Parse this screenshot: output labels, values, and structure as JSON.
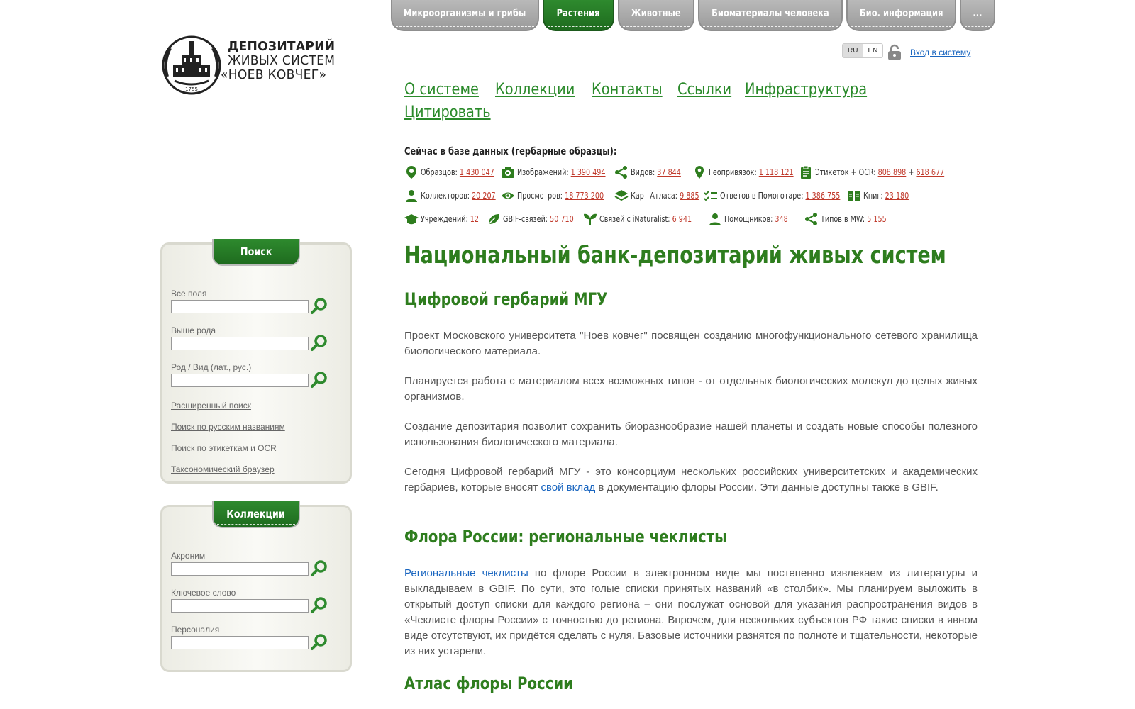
{
  "tabs": [
    {
      "label": "Микроорганизмы и грибы",
      "active": false
    },
    {
      "label": "Растения",
      "active": true
    },
    {
      "label": "Животные",
      "active": false
    },
    {
      "label": "Биоматериалы человека",
      "active": false
    },
    {
      "label": "Био. информация",
      "active": false
    },
    {
      "label": "...",
      "active": false
    }
  ],
  "logo": {
    "line1": "ДЕПОЗИТАРИЙ",
    "line2": "ЖИВЫХ СИСТЕМ",
    "line3": "«НОЕВ КОВЧЕГ»",
    "year": "1755"
  },
  "lang": {
    "ru": "RU",
    "en": "EN"
  },
  "login": "Вход в систему",
  "menu": [
    "О системе",
    "Коллекции",
    "Контакты",
    "Ссылки",
    "Инфраструктура",
    "Цитировать"
  ],
  "stats": {
    "title": "Сейчас в базе данных (гербарные образцы):",
    "row1": [
      {
        "icon": "leaf-pin-icon",
        "label": "Образцов:",
        "value": "1 430 047"
      },
      {
        "icon": "camera-icon",
        "label": "Изображений:",
        "value": "1 390 494"
      },
      {
        "icon": "share-icon",
        "label": "Видов:",
        "value": "37 844"
      },
      {
        "icon": "map-pin-icon",
        "label": "Геопривязок:",
        "value": "1 118 121"
      },
      {
        "icon": "clipboard-icon",
        "label": "Этикеток + OCR:",
        "value": "808 898",
        "plus": "+",
        "value2": "618 677"
      }
    ],
    "row2": [
      {
        "icon": "person-icon",
        "label": "Коллекторов:",
        "value": "20 207"
      },
      {
        "icon": "eye-icon",
        "label": "Просмотров:",
        "value": "18 773 200"
      },
      {
        "icon": "layers-icon",
        "label": "Карт Атласа:",
        "value": "9 885"
      },
      {
        "icon": "checklist-icon",
        "label": "Ответов в Помоготаре:",
        "value": "1 386 755"
      },
      {
        "icon": "book-icon",
        "label": "Книг:",
        "value": "23 180"
      }
    ],
    "row3": [
      {
        "icon": "graduation-cap-icon",
        "label": "Учреждений:",
        "value": "12"
      },
      {
        "icon": "leaf-icon",
        "label": "GBIF-связей:",
        "value": "50 710"
      },
      {
        "icon": "sprout-icon",
        "label": "Связей с iNaturalist:",
        "value": "6 941"
      },
      {
        "icon": "person-icon",
        "label": "Помощников:",
        "value": "348"
      },
      {
        "icon": "share-icon",
        "label": "Типов в MW:",
        "value": "5 155"
      }
    ]
  },
  "search": {
    "title": "Поиск",
    "fields": [
      "Все поля",
      "Выше рода",
      "Род / Вид (лат., рус.)"
    ],
    "links": [
      "Расширенный поиск",
      "Поиск по русским названиям",
      "Поиск по этикеткам и OCR",
      "Таксономический браузер"
    ]
  },
  "collections": {
    "title": "Коллекции",
    "fields": [
      "Акроним",
      "Ключевое слово",
      "Персоналия"
    ]
  },
  "main": {
    "h1": "Национальный банк-депозитарий живых систем",
    "h2a": "Цифровой гербарий МГУ",
    "p1": "Проект Московского университета \"Ноев ковчег\" посвящен созданию многофункционального сетевого хранилища биологического материала.",
    "p2": "Планируется работа с материалом всех возможных типов - от отдельных биологических молекул до целых живых организмов.",
    "p3": "Создание депозитария позволит сохранить биоразнообразие нашей планеты и создать новые способы полезного использования биологического материала.",
    "p4a": "Сегодня Цифровой гербарий МГУ - это консорциум нескольких российских университетских и академических гербариев, которые вносят ",
    "p4link": "свой вклад",
    "p4b": " в документацию флоры России. Эти данные доступны также в GBIF.",
    "h2b": "Флора России: региональные чеклисты",
    "p5link": "Региональные чеклисты",
    "p5": " по флоре России в электронном виде мы постепенно извлекаем из литературы и выкладываем в GBIF. По сути, это голые списки принятых названий «в столбик». Мы планируем выложить в открытый доступ списки для каждого региона – они послужат основой для указания распространения видов в «Чеклисте флоры России» с точностью до региона. Впрочем, для нескольких субъектов РФ такие списки в явном виде отсутствуют, их придётся сделать с нуля. Базовые источники разнятся по полноте и тщательности, некоторые из них устарели.",
    "h2c": "Атлас флоры России"
  }
}
